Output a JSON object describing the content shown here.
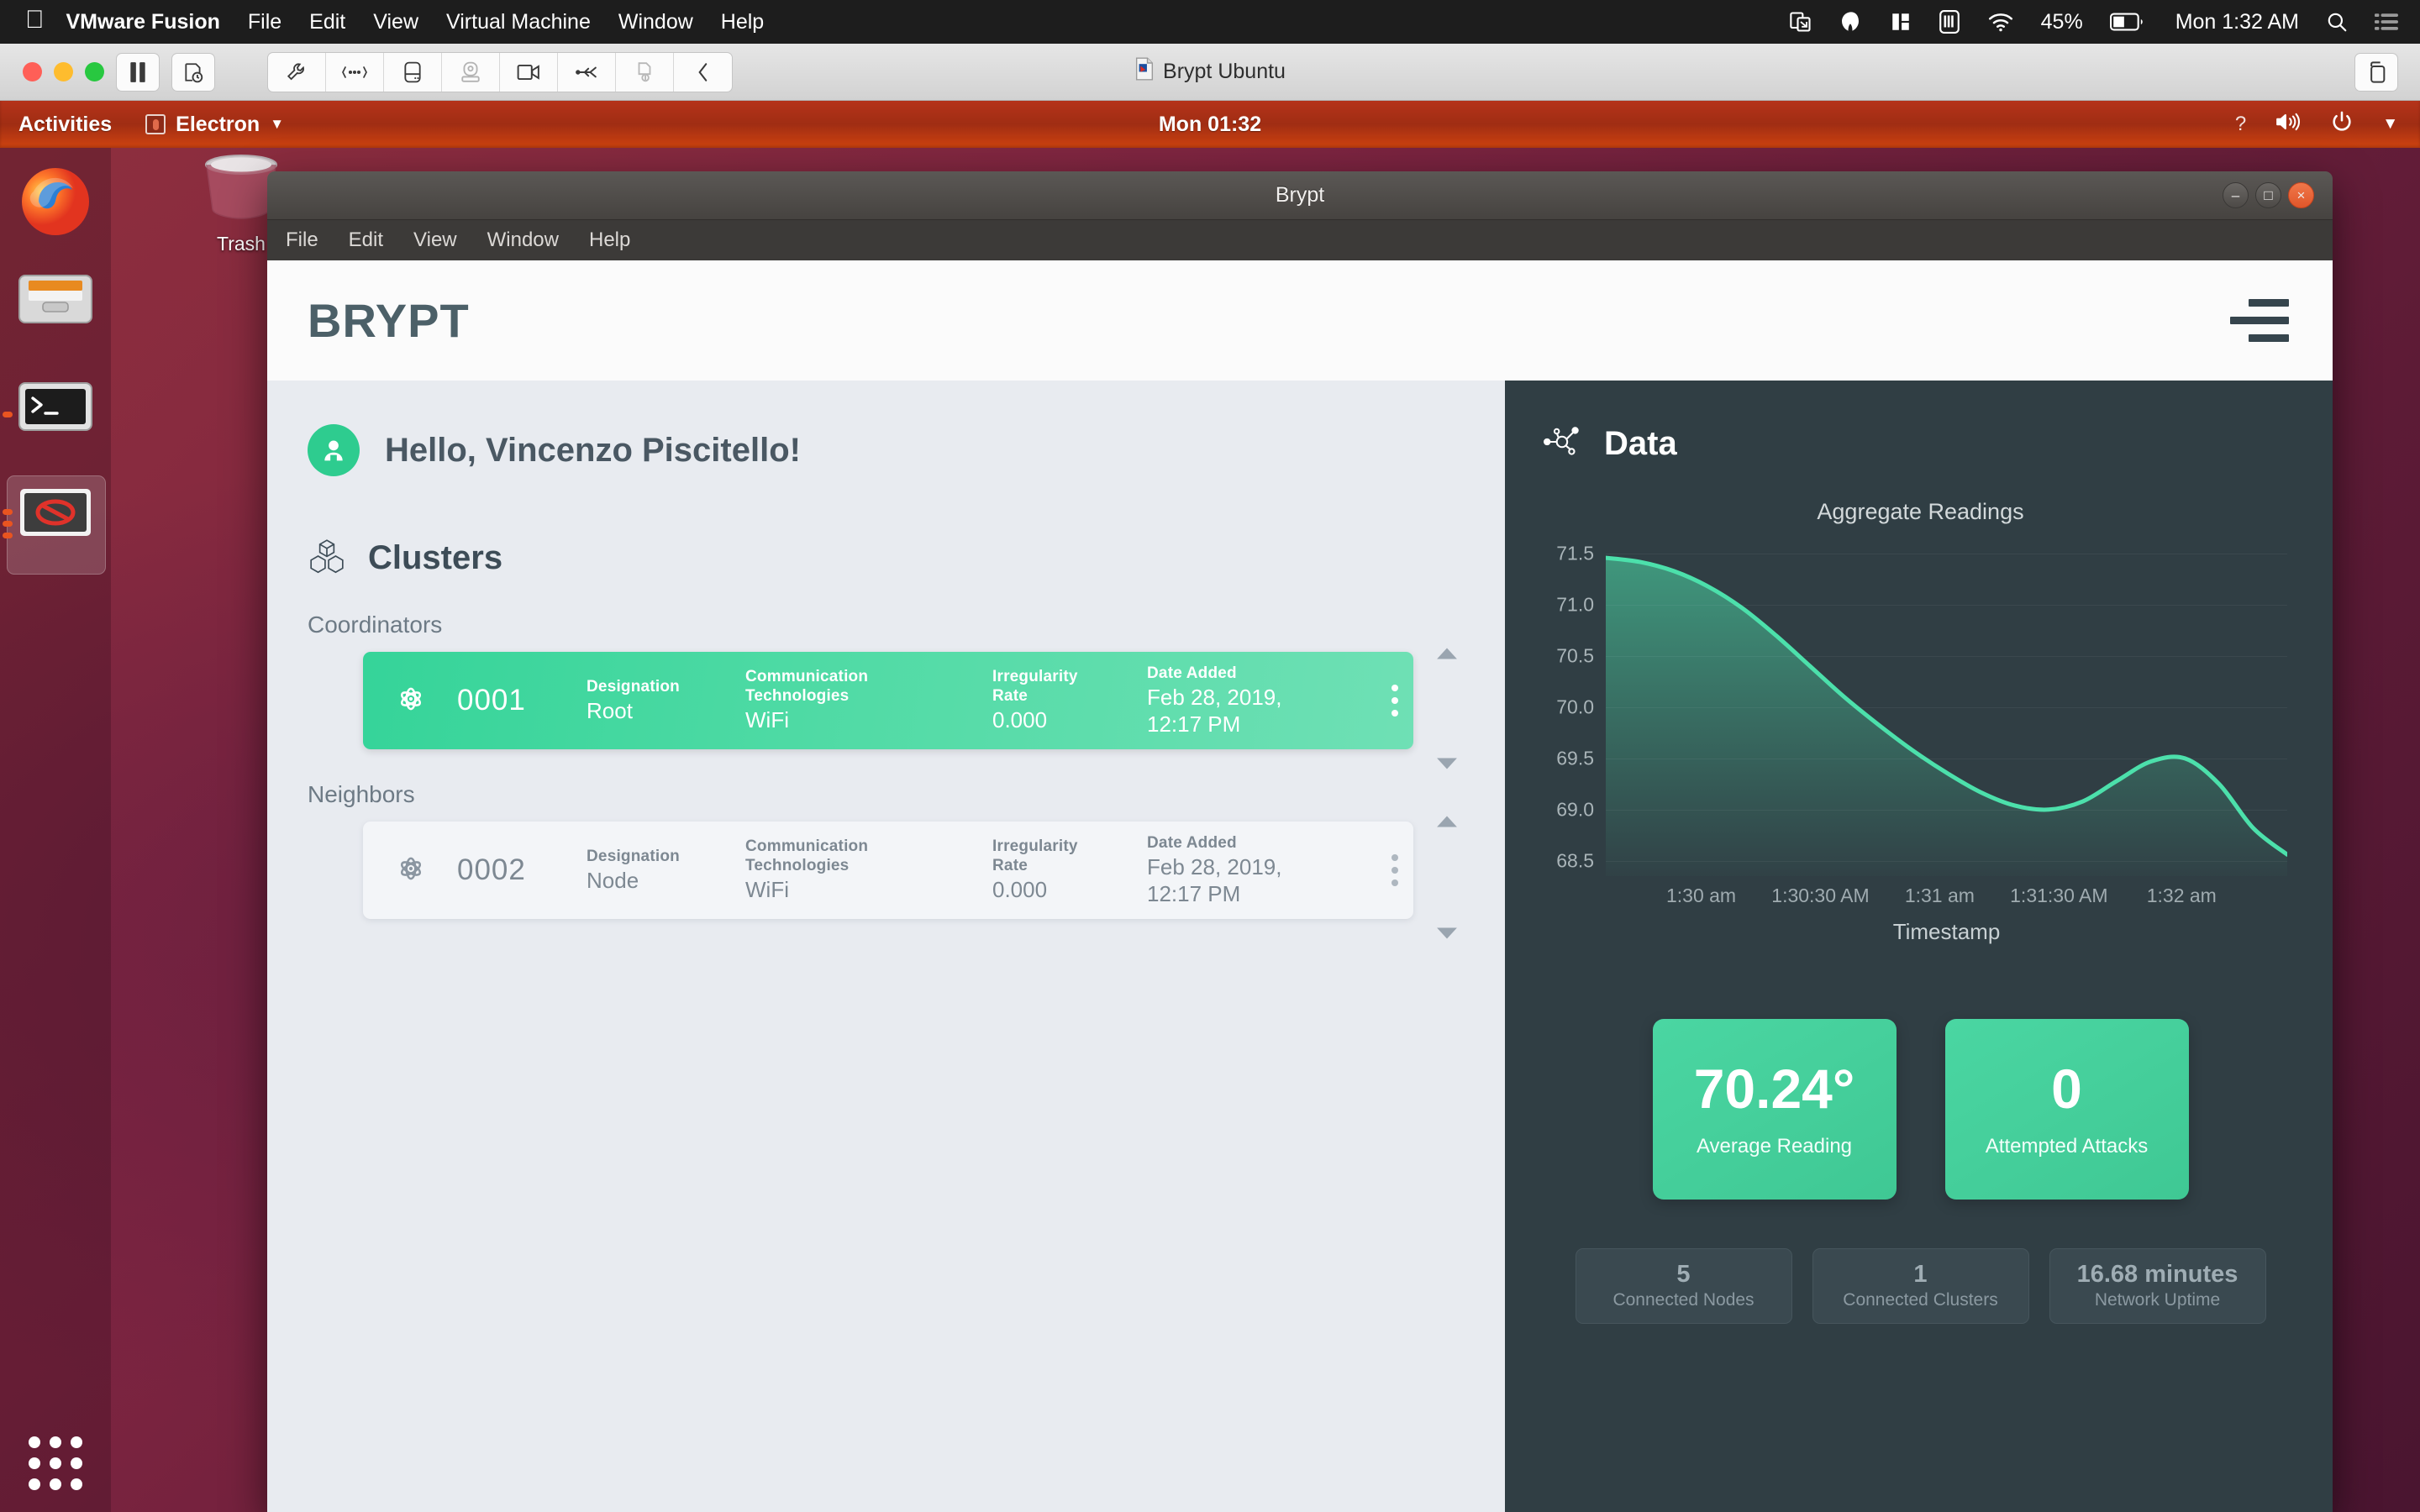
{
  "mac_menubar": {
    "apple_icon": "apple-icon",
    "items": [
      {
        "label": "VMware Fusion",
        "bold": true
      },
      {
        "label": "File",
        "bold": false
      },
      {
        "label": "Edit",
        "bold": false
      },
      {
        "label": "View",
        "bold": false
      },
      {
        "label": "Virtual Machine",
        "bold": false
      },
      {
        "label": "Window",
        "bold": false
      },
      {
        "label": "Help",
        "bold": false
      }
    ],
    "status_icons": [
      "screen-share-icon",
      "malwarebytes-icon",
      "window-layout-icon",
      "sim-card-icon",
      "wifi-icon"
    ],
    "battery_percent": "45%",
    "clock": "Mon 1:32 AM",
    "search_icon": "search-icon",
    "control_center_icon": "control-center-icon"
  },
  "vmware_window": {
    "title": "Brypt Ubuntu",
    "document_icon": "vm-document-icon",
    "traffic_lights": [
      "close-button",
      "minimize-button",
      "zoom-button"
    ],
    "left_buttons": [
      "pause-button",
      "snapshot-button"
    ],
    "toolbar_icons": [
      "settings-wrench-icon",
      "network-icon",
      "hard-disk-icon",
      "printer-icon",
      "camera-icon",
      "usb-icon",
      "shared-folder-icon",
      "collapse-chevron-icon"
    ],
    "right_button": "full-screen-icon"
  },
  "ubuntu": {
    "topbar": {
      "activities": "Activities",
      "app_name": "Electron",
      "app_icon": "electron-icon",
      "dropdown_icon": "chevron-down-icon",
      "clock": "Mon 01:32",
      "right_icons": [
        "help-icon",
        "volume-icon",
        "power-icon",
        "chevron-down-icon"
      ]
    },
    "dock": [
      {
        "name": "firefox",
        "label": "Firefox",
        "running": false,
        "active": false
      },
      {
        "name": "files",
        "label": "Files",
        "running": false,
        "active": false
      },
      {
        "name": "terminal",
        "label": "Terminal",
        "running": true,
        "active": false
      },
      {
        "name": "electron",
        "label": "Electron",
        "running": true,
        "active": true
      }
    ],
    "show_apps_label": "Show Applications",
    "trash_label": "Trash"
  },
  "brypt": {
    "window_title": "Brypt",
    "window_buttons": [
      {
        "name": "minimize",
        "glyph": "–"
      },
      {
        "name": "maximize",
        "glyph": "□"
      },
      {
        "name": "close",
        "glyph": "×"
      }
    ],
    "menubar": [
      "File",
      "Edit",
      "View",
      "Window",
      "Help"
    ],
    "logo": "BRYPT",
    "hamburger_icon": "hamburger-menu-icon",
    "left": {
      "avatar_icon": "user-avatar-icon",
      "greeting": "Hello, Vincenzo Piscitello!",
      "clusters_icon": "clusters-cube-icon",
      "clusters_title": "Clusters",
      "sections": [
        {
          "label": "Coordinators",
          "scroll_up_icon": "scroll-up-arrow",
          "scroll_down_icon": "scroll-down-arrow",
          "rows": [
            {
              "node_icon": "node-atom-icon",
              "id": "0001",
              "designation_key": "Designation",
              "designation_value": "Root",
              "comm_key": "Communication Technologies",
              "comm_value": "WiFi",
              "irregularity_key": "Irregularity Rate",
              "irregularity_value": "0.000",
              "date_key": "Date Added",
              "date_value": "Feb 28, 2019, 12:17 PM",
              "menu_icon": "kebab-menu-icon",
              "highlighted": true
            }
          ]
        },
        {
          "label": "Neighbors",
          "scroll_up_icon": "scroll-up-arrow",
          "scroll_down_icon": "scroll-down-arrow",
          "rows": [
            {
              "node_icon": "node-atom-icon",
              "id": "0002",
              "designation_key": "Designation",
              "designation_value": "Node",
              "comm_key": "Communication Technologies",
              "comm_value": "WiFi",
              "irregularity_key": "Irregularity Rate",
              "irregularity_value": "0.000",
              "date_key": "Date Added",
              "date_value": "Feb 28, 2019, 12:17 PM",
              "menu_icon": "kebab-menu-icon",
              "highlighted": false
            }
          ]
        }
      ]
    },
    "right": {
      "data_icon": "data-network-icon",
      "data_title": "Data",
      "big_cards": [
        {
          "value": "70.24°",
          "caption": "Average Reading"
        },
        {
          "value": "0",
          "caption": "Attempted Attacks"
        }
      ],
      "small_cards": [
        {
          "value": "5",
          "caption": "Connected Nodes"
        },
        {
          "value": "1",
          "caption": "Connected Clusters"
        },
        {
          "value": "16.68 minutes",
          "caption": "Network Uptime"
        }
      ]
    }
  },
  "colors": {
    "accent_green": "#35d499",
    "panel_dark": "#303e44",
    "panel_light": "#e8ebf0",
    "logo_slate": "#4c6068",
    "ubuntu_orange": "#e95420"
  },
  "chart_data": {
    "type": "area",
    "title": "Aggregate Readings",
    "xlabel": "Timestamp",
    "ylabel": "",
    "ylim": [
      68.35,
      71.6
    ],
    "yticks": [
      "71.5",
      "71.0",
      "70.5",
      "70.0",
      "69.5",
      "69.0",
      "68.5"
    ],
    "ytick_values": [
      71.5,
      71.0,
      70.5,
      70.0,
      69.5,
      69.0,
      68.5
    ],
    "xticks": [
      "1:30 am",
      "1:30:30 AM",
      "1:31 am",
      "1:31:30 AM",
      "1:32 am"
    ],
    "xtick_positions": [
      0.14,
      0.315,
      0.49,
      0.665,
      0.845
    ],
    "grid": true,
    "legend": null,
    "line_color": "#4ce0ab",
    "fill_gradient": [
      "rgba(76,224,171,0.55)",
      "rgba(76,224,171,0.02)"
    ],
    "series": [
      {
        "name": "Aggregate Readings",
        "x": [
          0.0,
          0.05,
          0.1,
          0.15,
          0.2,
          0.25,
          0.3,
          0.35,
          0.4,
          0.45,
          0.5,
          0.55,
          0.6,
          0.65,
          0.7,
          0.75,
          0.8,
          0.85,
          0.9,
          0.95,
          1.0
        ],
        "values": [
          71.46,
          71.42,
          71.33,
          71.18,
          70.97,
          70.7,
          70.4,
          70.1,
          69.83,
          69.58,
          69.36,
          69.17,
          69.04,
          69.0,
          69.08,
          69.28,
          69.47,
          69.5,
          69.25,
          68.82,
          68.56
        ]
      }
    ]
  }
}
